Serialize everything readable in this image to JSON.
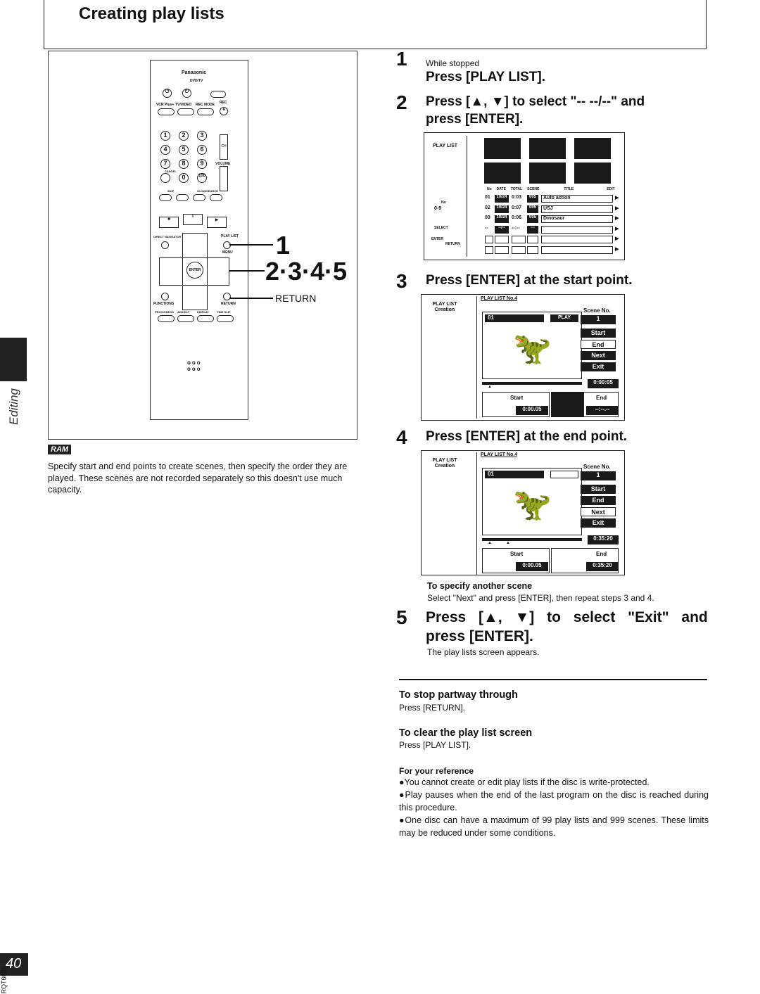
{
  "page": {
    "title": "Creating play lists",
    "side_label": "Editing",
    "page_number": "40",
    "doc_code": "RQT6636"
  },
  "remote": {
    "brand": "Panasonic",
    "model": "DVD/TV",
    "labels": {
      "vcr_plus": "VCR Plus+",
      "tv_video": "TV/VIDEO",
      "rec_mode": "REC MODE",
      "rec": "REC",
      "ch": "CH",
      "volume": "VOLUME",
      "cancel": "CANCEL",
      "skip": "SKIP",
      "slow_search": "SLOW/SEARCH",
      "direct_navigator": "DIRECT NAVIGATOR",
      "top": "TOP",
      "play_list": "PLAY LIST",
      "menu": "MENU",
      "enter": "ENTER",
      "functions": "FUNCTIONS",
      "return": "RETURN",
      "prog_check": "PROG/CHECK",
      "add_dlt": "ADD/DLT",
      "display": "DISPLAY",
      "time_slip": "TIME SLIP"
    },
    "digits": [
      "1",
      "2",
      "3",
      "4",
      "5",
      "6",
      "7",
      "8",
      "9",
      "0",
      "100"
    ],
    "callouts": {
      "one": "1",
      "multi": "2·3·4·5",
      "return": "RETURN"
    }
  },
  "intro": {
    "badge": "RAM",
    "text": "Specify start and end points to create scenes, then specify the order they are played. These scenes are not recorded separately so this doesn't use much capacity."
  },
  "steps": [
    {
      "num": "1",
      "condition": "While stopped",
      "text": "Press [PLAY LIST]."
    },
    {
      "num": "2",
      "text": "Press [▲, ▼] to select \"-- --/--\" and",
      "text2": "press [ENTER]."
    },
    {
      "num": "3",
      "text": "Press [ENTER] at the start point."
    },
    {
      "num": "4",
      "text": "Press [ENTER] at the end point."
    },
    {
      "num": "5",
      "text": "Press [▲, ▼] to select \"Exit\" and",
      "text2": "press [ENTER].",
      "note": "The play lists screen appears."
    }
  ],
  "screen_list": {
    "title": "PLAY LIST",
    "no_label": "No",
    "range": [
      "0",
      "9"
    ],
    "select": "SELECT",
    "enter": "ENTER",
    "return": "RETURN",
    "columns": [
      "No",
      "DATE",
      "TOTAL",
      "SCENE",
      "TITLE",
      "EDIT"
    ],
    "rows": [
      {
        "no": "01",
        "date": "10/24",
        "total": "0:03",
        "scene": "005",
        "title": "Auto action"
      },
      {
        "no": "02",
        "date": "10/24",
        "total": "0:07",
        "scene": "005",
        "title": "USJ"
      },
      {
        "no": "03",
        "date": "10/24",
        "total": "0:06",
        "scene": "005",
        "title": "Dinosaur"
      },
      {
        "no": "--",
        "date": "--/--",
        "total": "--:--",
        "scene": "---",
        "title": ""
      }
    ]
  },
  "screen_start": {
    "side": "PLAY LIST Creation",
    "header": "PLAY LIST No.4",
    "scene_label": "Scene No.",
    "scene": "1",
    "clip": "01",
    "status": "PLAY",
    "menu": [
      "Start",
      "End",
      "Next",
      "Exit"
    ],
    "time": "0:00:05",
    "start_label": "Start",
    "start_time": "0:00.05",
    "end_label": "End",
    "end_time": "--:--.--"
  },
  "screen_end": {
    "side": "PLAY LIST Creation",
    "header": "PLAY LIST No.4",
    "scene_label": "Scene No.",
    "scene": "1",
    "clip": "01",
    "menu": [
      "Start",
      "End",
      "Next",
      "Exit"
    ],
    "time": "0:35:20",
    "start_label": "Start",
    "start_time": "0:00.05",
    "end_label": "End",
    "end_time": "0:35:20"
  },
  "another": {
    "heading": "To specify another scene",
    "text": "Select \"Next\" and press [ENTER], then repeat steps 3 and 4."
  },
  "stop": {
    "heading": "To stop partway through",
    "text": "Press [RETURN]."
  },
  "clear": {
    "heading": "To clear the play list screen",
    "text": "Press [PLAY LIST]."
  },
  "reference": {
    "heading": "For your reference",
    "bullets": [
      "●You cannot create or edit play lists if the disc is write-protected.",
      "●Play pauses when the end of the last program on the disc is reached during this procedure.",
      "●One disc can have a maximum of 99 play lists and 999 scenes. These limits may be reduced under some conditions."
    ]
  }
}
